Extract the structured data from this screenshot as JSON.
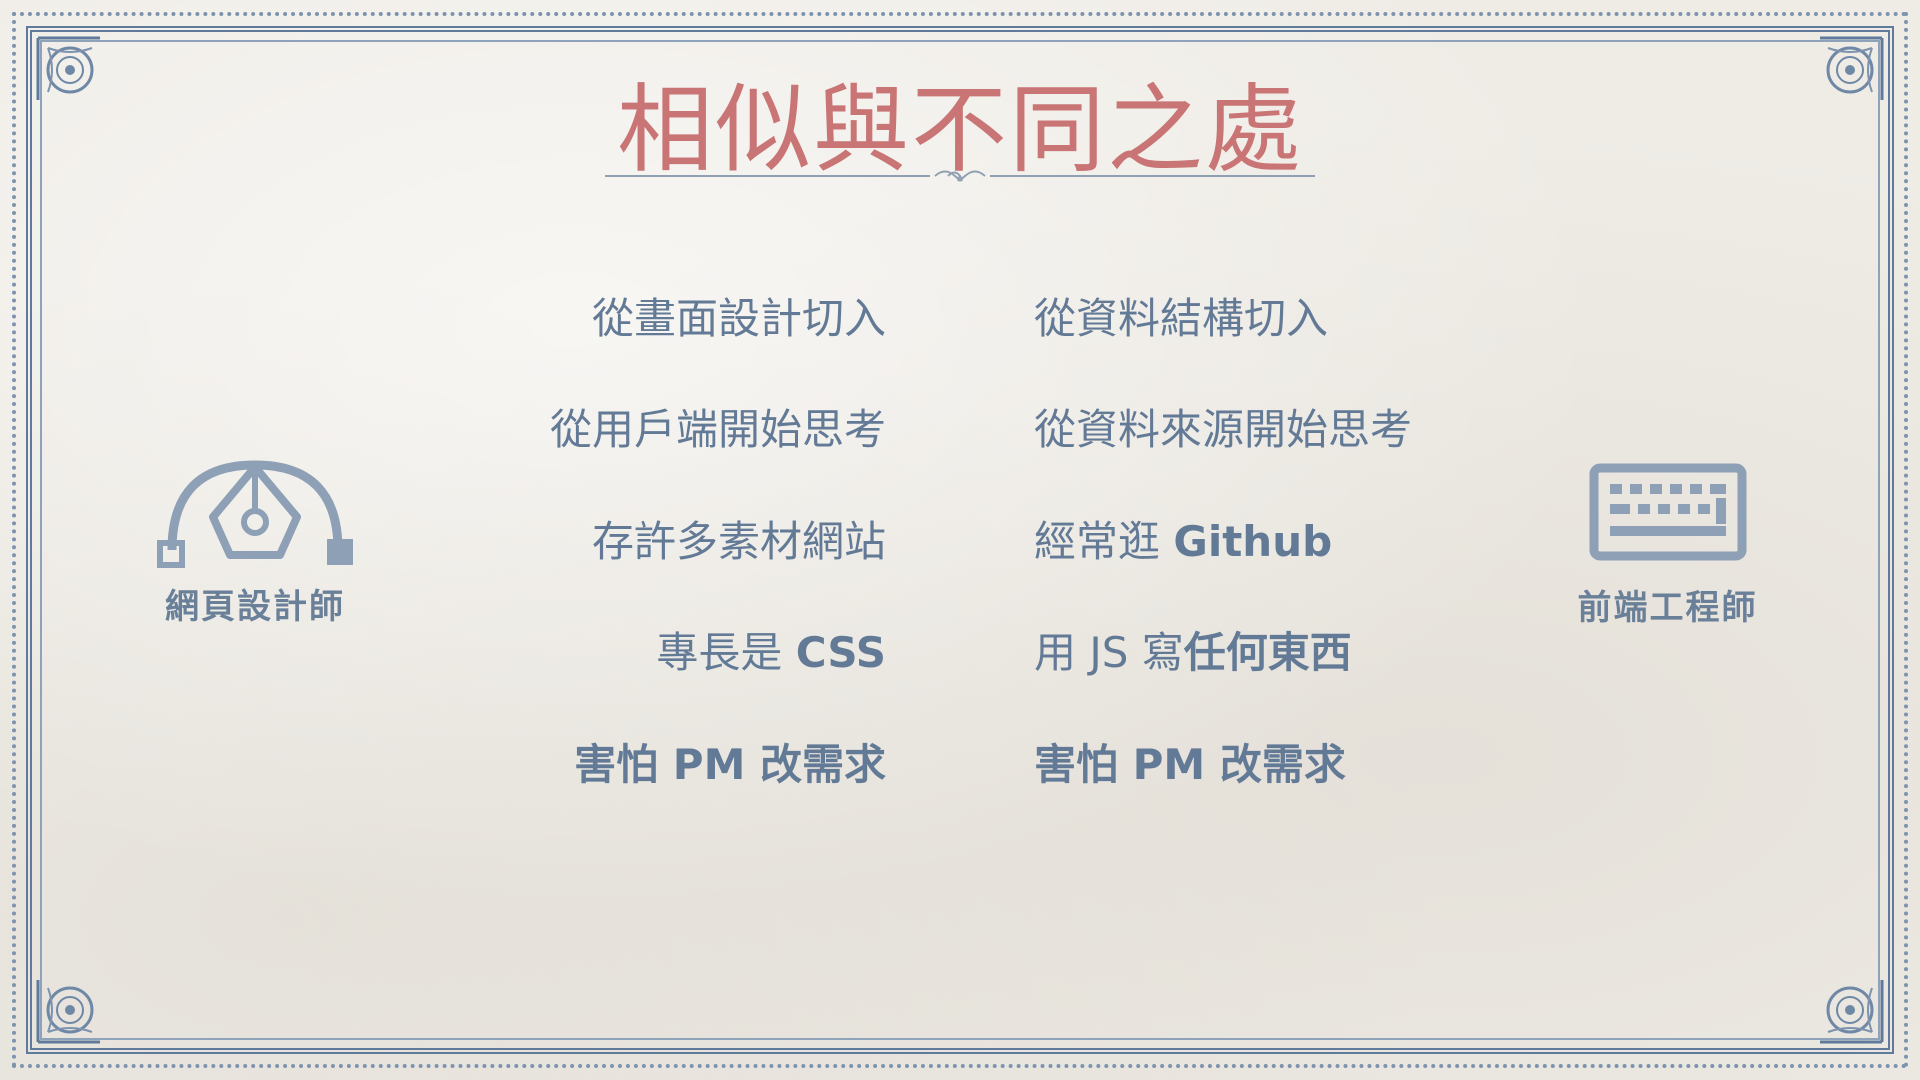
{
  "slide": {
    "title": "相似與不同之處"
  },
  "roles": {
    "designer": {
      "label": "網頁設計師",
      "icon": "pen-nib-icon"
    },
    "engineer": {
      "label": "前端工程師",
      "icon": "keyboard-icon"
    }
  },
  "designer_points": [
    {
      "normal": "從畫面設計切入",
      "bold": ""
    },
    {
      "normal": "從用戶端開始思考",
      "bold": ""
    },
    {
      "normal": "存許多素材網站",
      "bold": ""
    },
    {
      "normal": "專長是 ",
      "bold": "CSS"
    },
    {
      "normal": "",
      "bold": "害怕 PM 改需求"
    }
  ],
  "engineer_points": [
    {
      "normal": "從資料結構切入",
      "bold": ""
    },
    {
      "normal": "從資料來源開始思考",
      "bold": ""
    },
    {
      "normal": "經常逛 ",
      "bold": "Github"
    },
    {
      "normal": "用 JS 寫",
      "bold": "任何東西"
    },
    {
      "normal": "",
      "bold": "害怕 PM 改需求"
    }
  ],
  "colors": {
    "title": "#c97575",
    "text": "#637a96",
    "frame": "#5f7a9a",
    "background": "#efece6"
  }
}
